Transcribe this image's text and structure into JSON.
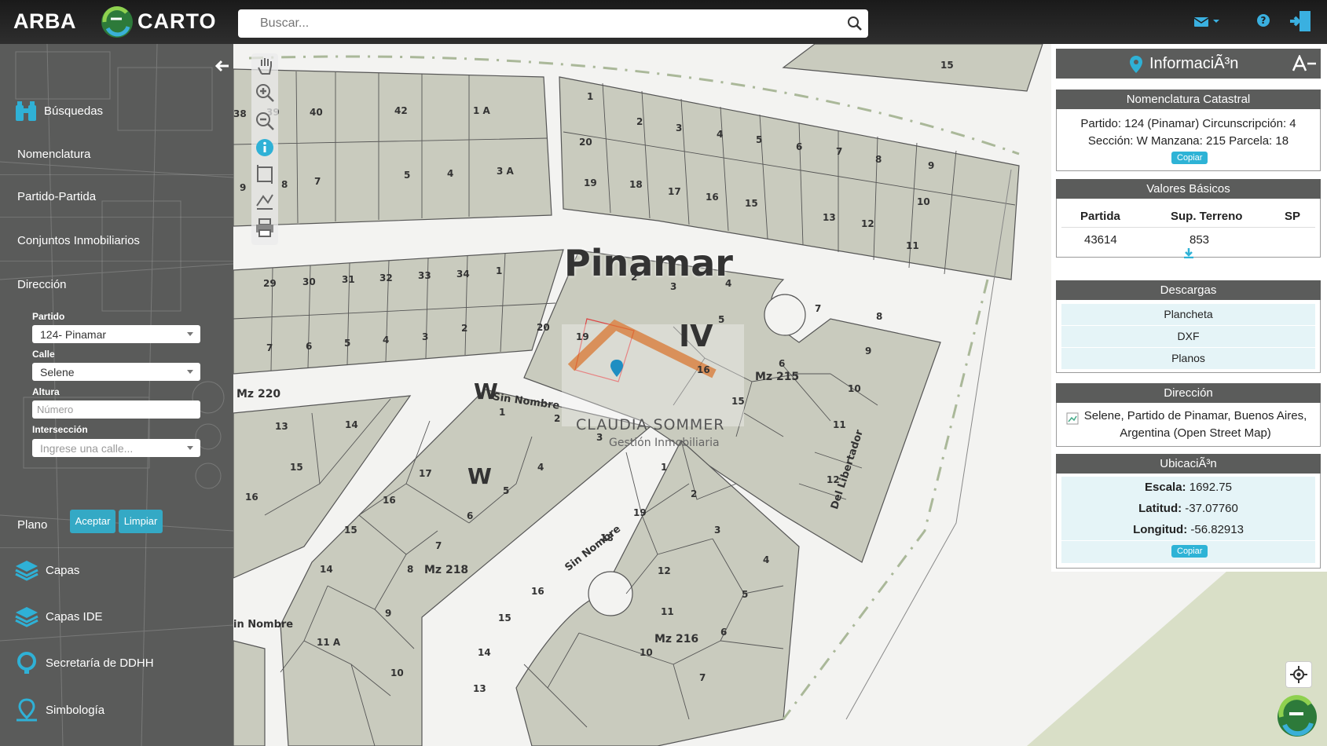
{
  "header": {
    "brand_left": "ARBA",
    "brand_carto": "CARTO",
    "search_placeholder": "Buscar...",
    "icons": [
      "mail-icon",
      "chevron-down-icon",
      "help-icon",
      "logout-icon"
    ]
  },
  "sidebar": {
    "busquedas": "Búsquedas",
    "nomenclatura": "Nomenclatura",
    "partido_partida": "Partido-Partida",
    "conjuntos": "Conjuntos Inmobiliarios",
    "direccion": "Dirección",
    "form": {
      "partido_label": "Partido",
      "partido_value": "124- Pinamar",
      "calle_label": "Calle",
      "calle_value": "Selene",
      "altura_label": "Altura",
      "altura_placeholder": "Número",
      "interseccion_label": "Intersección",
      "interseccion_placeholder": "Ingrese una calle...",
      "aceptar": "Aceptar",
      "limpiar": "Limpiar"
    },
    "plano": "Plano",
    "capas": "Capas",
    "capas_ide": "Capas IDE",
    "secretaria": "Secretaría de DDHH",
    "simbologia": "Simbología"
  },
  "map": {
    "city_label": "Pinamar",
    "circ_label": "IV",
    "section_labels": [
      "W",
      "W"
    ],
    "manzanas": [
      "Mz 220",
      "Mz 215",
      "Mz 218",
      "Mz 216"
    ],
    "streets": [
      "Sin Nombre",
      "Sin Nombre",
      "in Nombre",
      "Del Libertador"
    ],
    "watermark_name": "CLAUDIA SOMMER",
    "watermark_sub": "Gestión Inmobiliaria",
    "lots_top_left": [
      "40",
      "42",
      "1 A",
      "39",
      "38",
      "7",
      "5",
      "4",
      "3 A",
      "8",
      "9"
    ],
    "lots_top_mid": [
      "1",
      "2",
      "3",
      "4",
      "5",
      "6",
      "7",
      "8",
      "9",
      "20",
      "19",
      "18",
      "17",
      "16",
      "15",
      "13",
      "12",
      "11",
      "10",
      "15"
    ],
    "lots_row2": [
      "29",
      "30",
      "31",
      "32",
      "33",
      "34",
      "1",
      "7",
      "6",
      "5",
      "4",
      "3",
      "2"
    ],
    "lots_215": [
      "2",
      "3",
      "4",
      "5",
      "20",
      "19",
      "16",
      "15",
      "7",
      "8",
      "9",
      "10",
      "11",
      "12",
      "6"
    ],
    "lots_bottom": [
      "13",
      "14",
      "15",
      "16",
      "1",
      "2",
      "3",
      "17",
      "4",
      "5",
      "16",
      "6",
      "15",
      "7",
      "14",
      "8",
      "9",
      "11 A",
      "10",
      "1",
      "2",
      "19",
      "3",
      "18",
      "4",
      "12",
      "5",
      "16",
      "11",
      "6",
      "15",
      "10",
      "14",
      "7",
      "13"
    ]
  },
  "info": {
    "title": "InformaciÃ³n",
    "nomenclatura": {
      "header": "Nomenclatura Catastral",
      "line1": "Partido: 124 (Pinamar) Circunscripción: 4",
      "line2": "Sección: W Manzana: 215 Parcela: 18",
      "copy": "Copiar"
    },
    "valores": {
      "header": "Valores Básicos",
      "cols": [
        "Partida",
        "Sup. Terreno",
        "SP"
      ],
      "partida": "43614",
      "sup_terreno": "853",
      "sp": ""
    },
    "descargas": {
      "header": "Descargas",
      "items": [
        "Plancheta",
        "DXF",
        "Planos"
      ]
    },
    "direccion": {
      "header": "Dirección",
      "line1": "Selene, Partido de Pinamar, Buenos Aires,",
      "line2": "Argentina (Open Street Map)"
    },
    "ubicacion": {
      "header": "UbicaciÃ³n",
      "escala_label": "Escala:",
      "escala": "1692.75",
      "latitud_label": "Latitud:",
      "latitud": "-37.07760",
      "longitud_label": "Longitud:",
      "longitud": "-56.82913",
      "copy": "Copiar"
    }
  },
  "colors": {
    "topbar": "#1f1f1f",
    "sidebar": "#5a5b5a",
    "accent": "#34a9c5",
    "parcel_fill": "#c9cbbe",
    "parcel_stroke": "#444",
    "road": "#f3f3f1",
    "green_area": "#d9dfc7"
  }
}
